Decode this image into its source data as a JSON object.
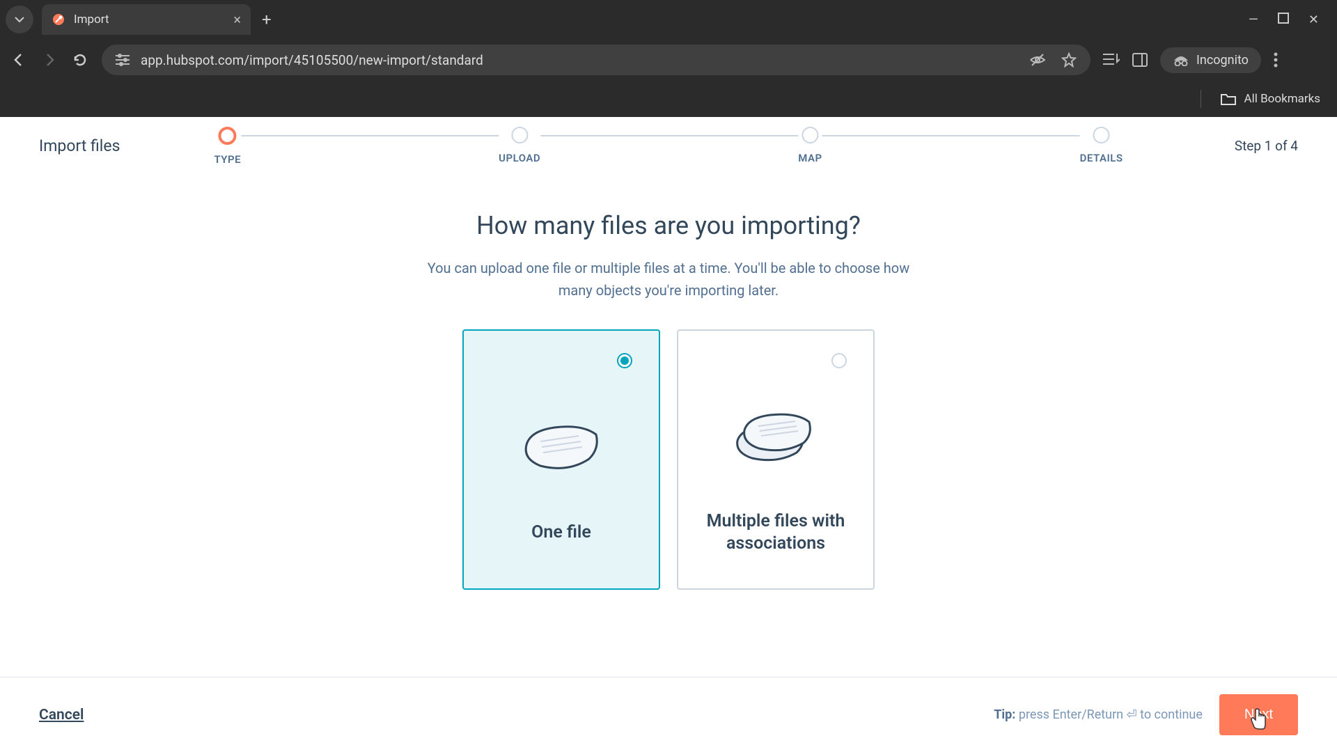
{
  "browser": {
    "tab_title": "Import",
    "url": "app.hubspot.com/import/45105500/new-import/standard",
    "incognito_label": "Incognito",
    "all_bookmarks": "All Bookmarks"
  },
  "wizard": {
    "title": "Import files",
    "step_indicator": "Step 1 of 4",
    "steps": [
      {
        "label": "TYPE"
      },
      {
        "label": "UPLOAD"
      },
      {
        "label": "MAP"
      },
      {
        "label": "DETAILS"
      }
    ]
  },
  "content": {
    "question": "How many files are you importing?",
    "subtext": "You can upload one file or multiple files at a time. You'll be able to choose how many objects you're importing later.",
    "cards": [
      {
        "title": "One file"
      },
      {
        "title": "Multiple files with associations"
      }
    ]
  },
  "footer": {
    "cancel": "Cancel",
    "tip_label": "Tip:",
    "tip_text": " press Enter/Return ⏎ to continue",
    "next": "Next"
  }
}
